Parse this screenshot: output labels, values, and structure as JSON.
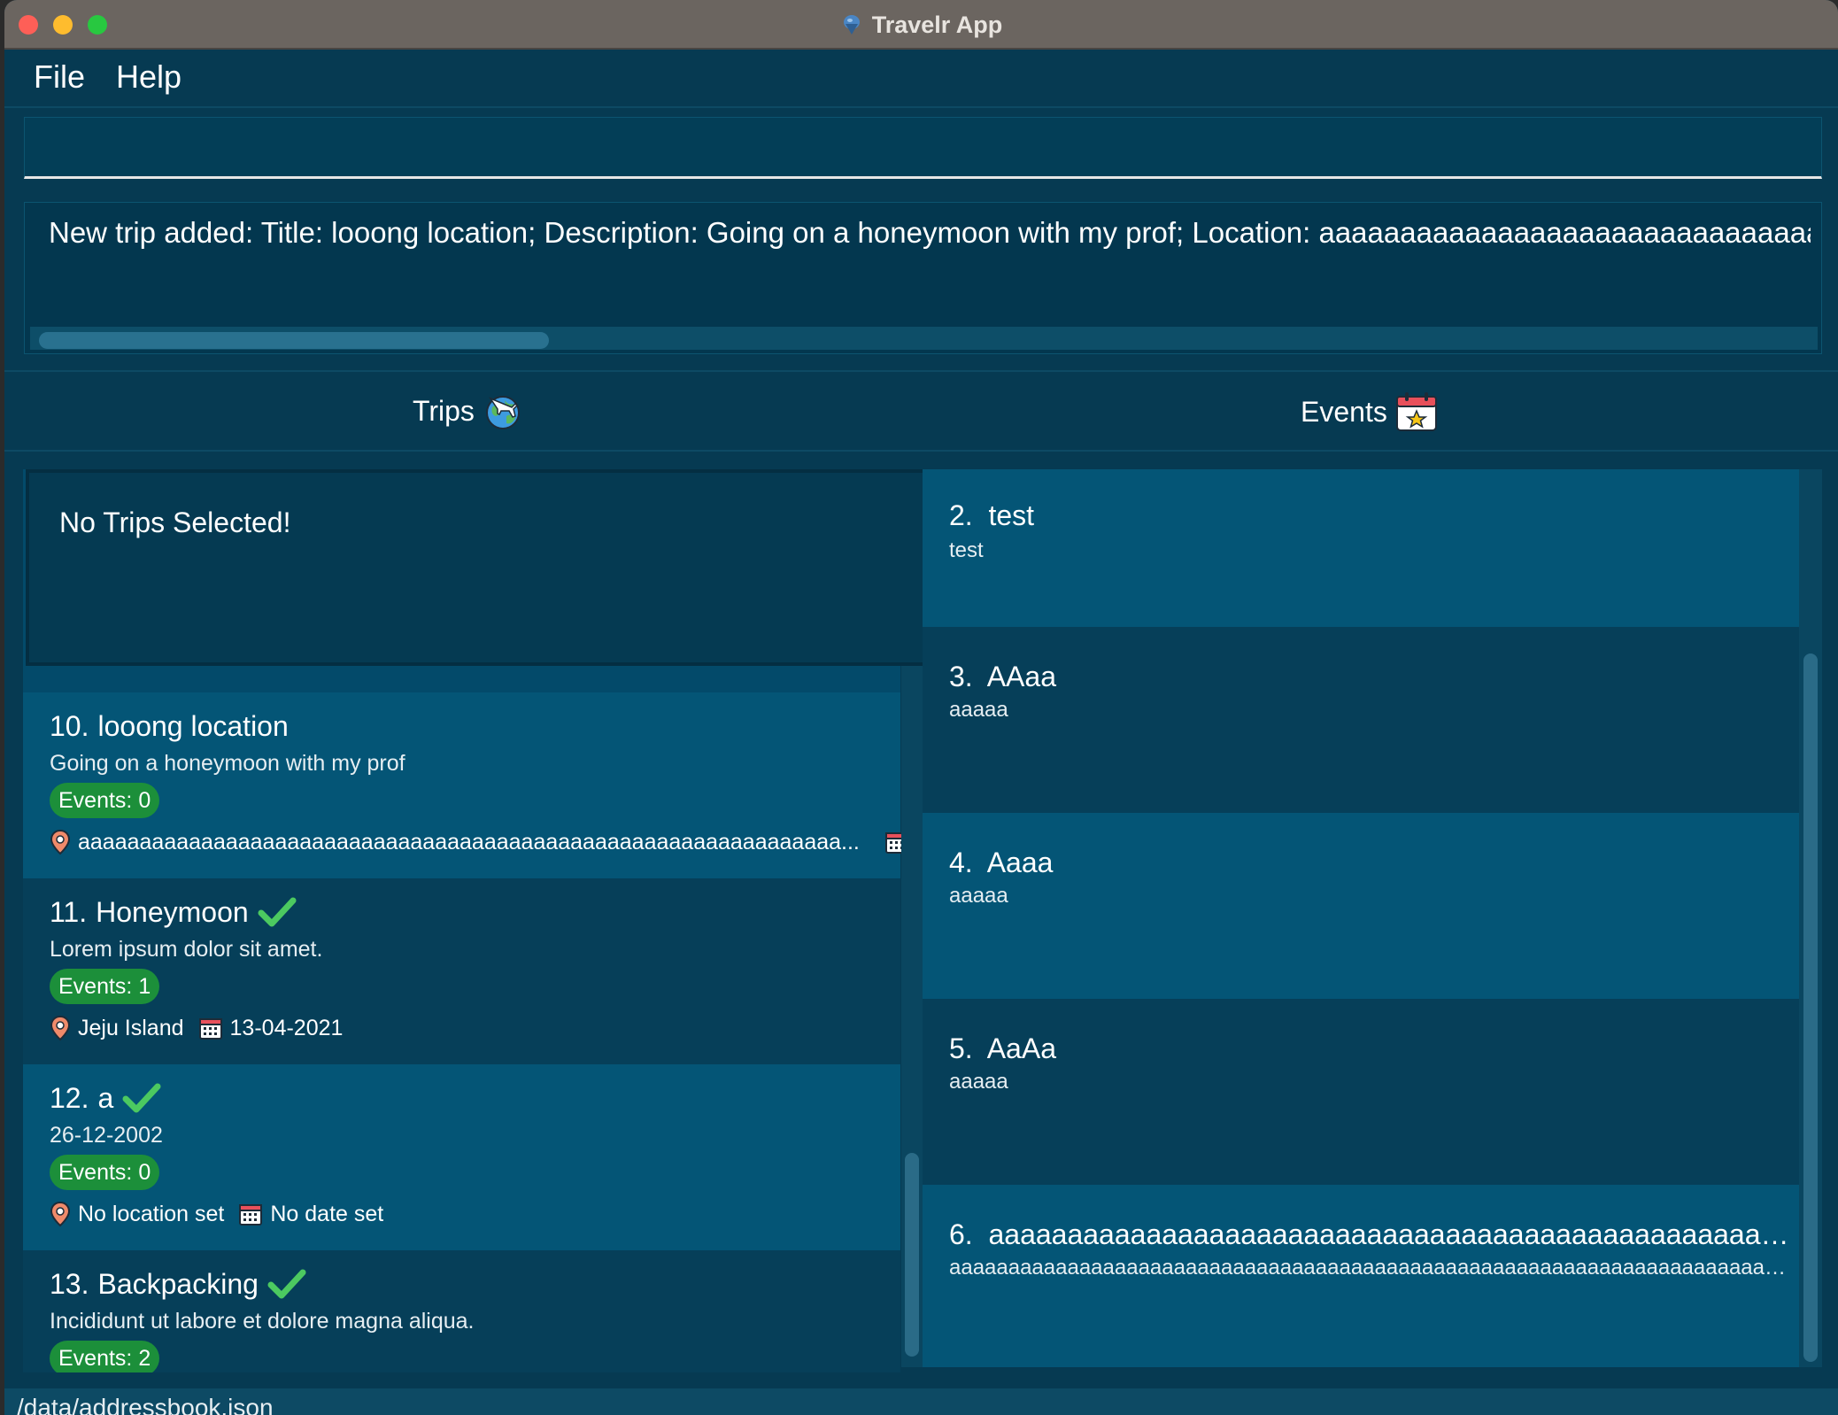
{
  "window": {
    "title": "Travelr App"
  },
  "menu": {
    "file_label": "File",
    "help_label": "Help"
  },
  "command": {
    "value": "",
    "placeholder": ""
  },
  "result": {
    "text": "New trip added: Title: looong location; Description: Going on a honeymoon with my prof; Location: aaaaaaaaaaaaaaaaaaaaaaaaaaaaaaaaaa"
  },
  "tabs": {
    "trips_label": "Trips",
    "trips_icon": "globe-airplane-icon",
    "events_label": "Events",
    "events_icon": "calendar-star-icon"
  },
  "trips": {
    "selected_placeholder": "No Trips Selected!",
    "items": [
      {
        "index": "10.",
        "title": "looong location",
        "completed": false,
        "description": "Going on a honeymoon with my prof",
        "events_badge": "Events: 0",
        "location": "aaaaaaaaaaaaaaaaaaaaaaaaaaaaaaaaaaaaaaaaaaaaaaaaaaaaaaaaaaaaaa...",
        "date": "..."
      },
      {
        "index": "11.",
        "title": "Honeymoon",
        "completed": true,
        "description": "Lorem ipsum dolor sit amet.",
        "events_badge": "Events: 1",
        "location": "Jeju Island",
        "date": "13-04-2021"
      },
      {
        "index": "12.",
        "title": "a",
        "completed": true,
        "description": "26-12-2002",
        "events_badge": "Events: 0",
        "location": "No location set",
        "date": "No date set"
      },
      {
        "index": "13.",
        "title": "Backpacking",
        "completed": true,
        "description": "Incididunt ut labore et dolore magna aliqua.",
        "events_badge": "Events: 2",
        "location": "",
        "date": ""
      }
    ]
  },
  "events": {
    "items": [
      {
        "index": "2.",
        "title": "test",
        "description": "test"
      },
      {
        "index": "3.",
        "title": "AAaa",
        "description": "aaaaa"
      },
      {
        "index": "4.",
        "title": "Aaaa",
        "description": "aaaaa"
      },
      {
        "index": "5.",
        "title": "AaAa",
        "description": "aaaaa"
      },
      {
        "index": "6.",
        "title": "aaaaaaaaaaaaaaaaaaaaaaaaaaaaaaaaaaaaaaaaaaaaaaaaaaaa...",
        "description": "aaaaaaaaaaaaaaaaaaaaaaaaaaaaaaaaaaaaaaaaaaaaaaaaaaaaaaaaaaaaaaaaaaaaaa..."
      }
    ]
  },
  "status": {
    "path": "/data/addressbook.json"
  },
  "colors": {
    "background": "#063a52",
    "card_light": "#045576",
    "card_dark": "#063f59",
    "badge_green": "#1c8f3a",
    "check_green": "#4cc960"
  }
}
